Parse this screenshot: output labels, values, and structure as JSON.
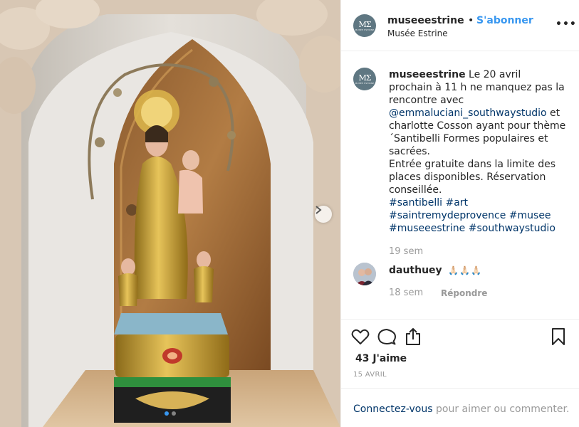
{
  "header": {
    "username": "museeestrine",
    "bullet": "•",
    "follow_label": "S'abonner",
    "location": "Musée Estrine",
    "more": "•••"
  },
  "profile": {
    "avatar_mark": "MΣ",
    "avatar_sub": "MUSÉE ESTRINE",
    "avatar_color": "#5f7782"
  },
  "caption": {
    "username": "museeestrine",
    "text_1": " Le 20 avril prochain à 11 h ne manquez pas la rencontre avec ",
    "mention_1": "@emmaluciani_southwaystudio",
    "text_2": " et charlotte Cosson ayant pour thème ´Santibelli Formes populaires et sacrées.",
    "text_3": "Entrée gratuite dans la limite des places disponibles. Réservation conseillée.",
    "tag_1": "#santibelli",
    "tag_2": "#art",
    "tag_3": "#saintremydeprovence",
    "tag_4": "#musee",
    "tag_5": "#museeestrine",
    "tag_6": "#southwaystudio",
    "time": "19 sem"
  },
  "comment": {
    "username": "dauthuey",
    "emoji": "🙏🏻🙏🏻🙏🏻",
    "time": "18 sem",
    "reply_label": "Répondre"
  },
  "actions": {
    "like_icon": "heart-icon",
    "comment_icon": "comment-icon",
    "share_icon": "share-icon",
    "save_icon": "bookmark-icon"
  },
  "likes": "43 J'aime",
  "date": "15 AVRIL",
  "login": {
    "link": "Connectez-vous",
    "rest": " pour aimer ou commenter."
  },
  "carousel": {
    "slides": 2,
    "active": 1
  },
  "colors": {
    "accent": "#3897f0",
    "link": "#003569",
    "muted": "#999999",
    "text": "#262626"
  }
}
